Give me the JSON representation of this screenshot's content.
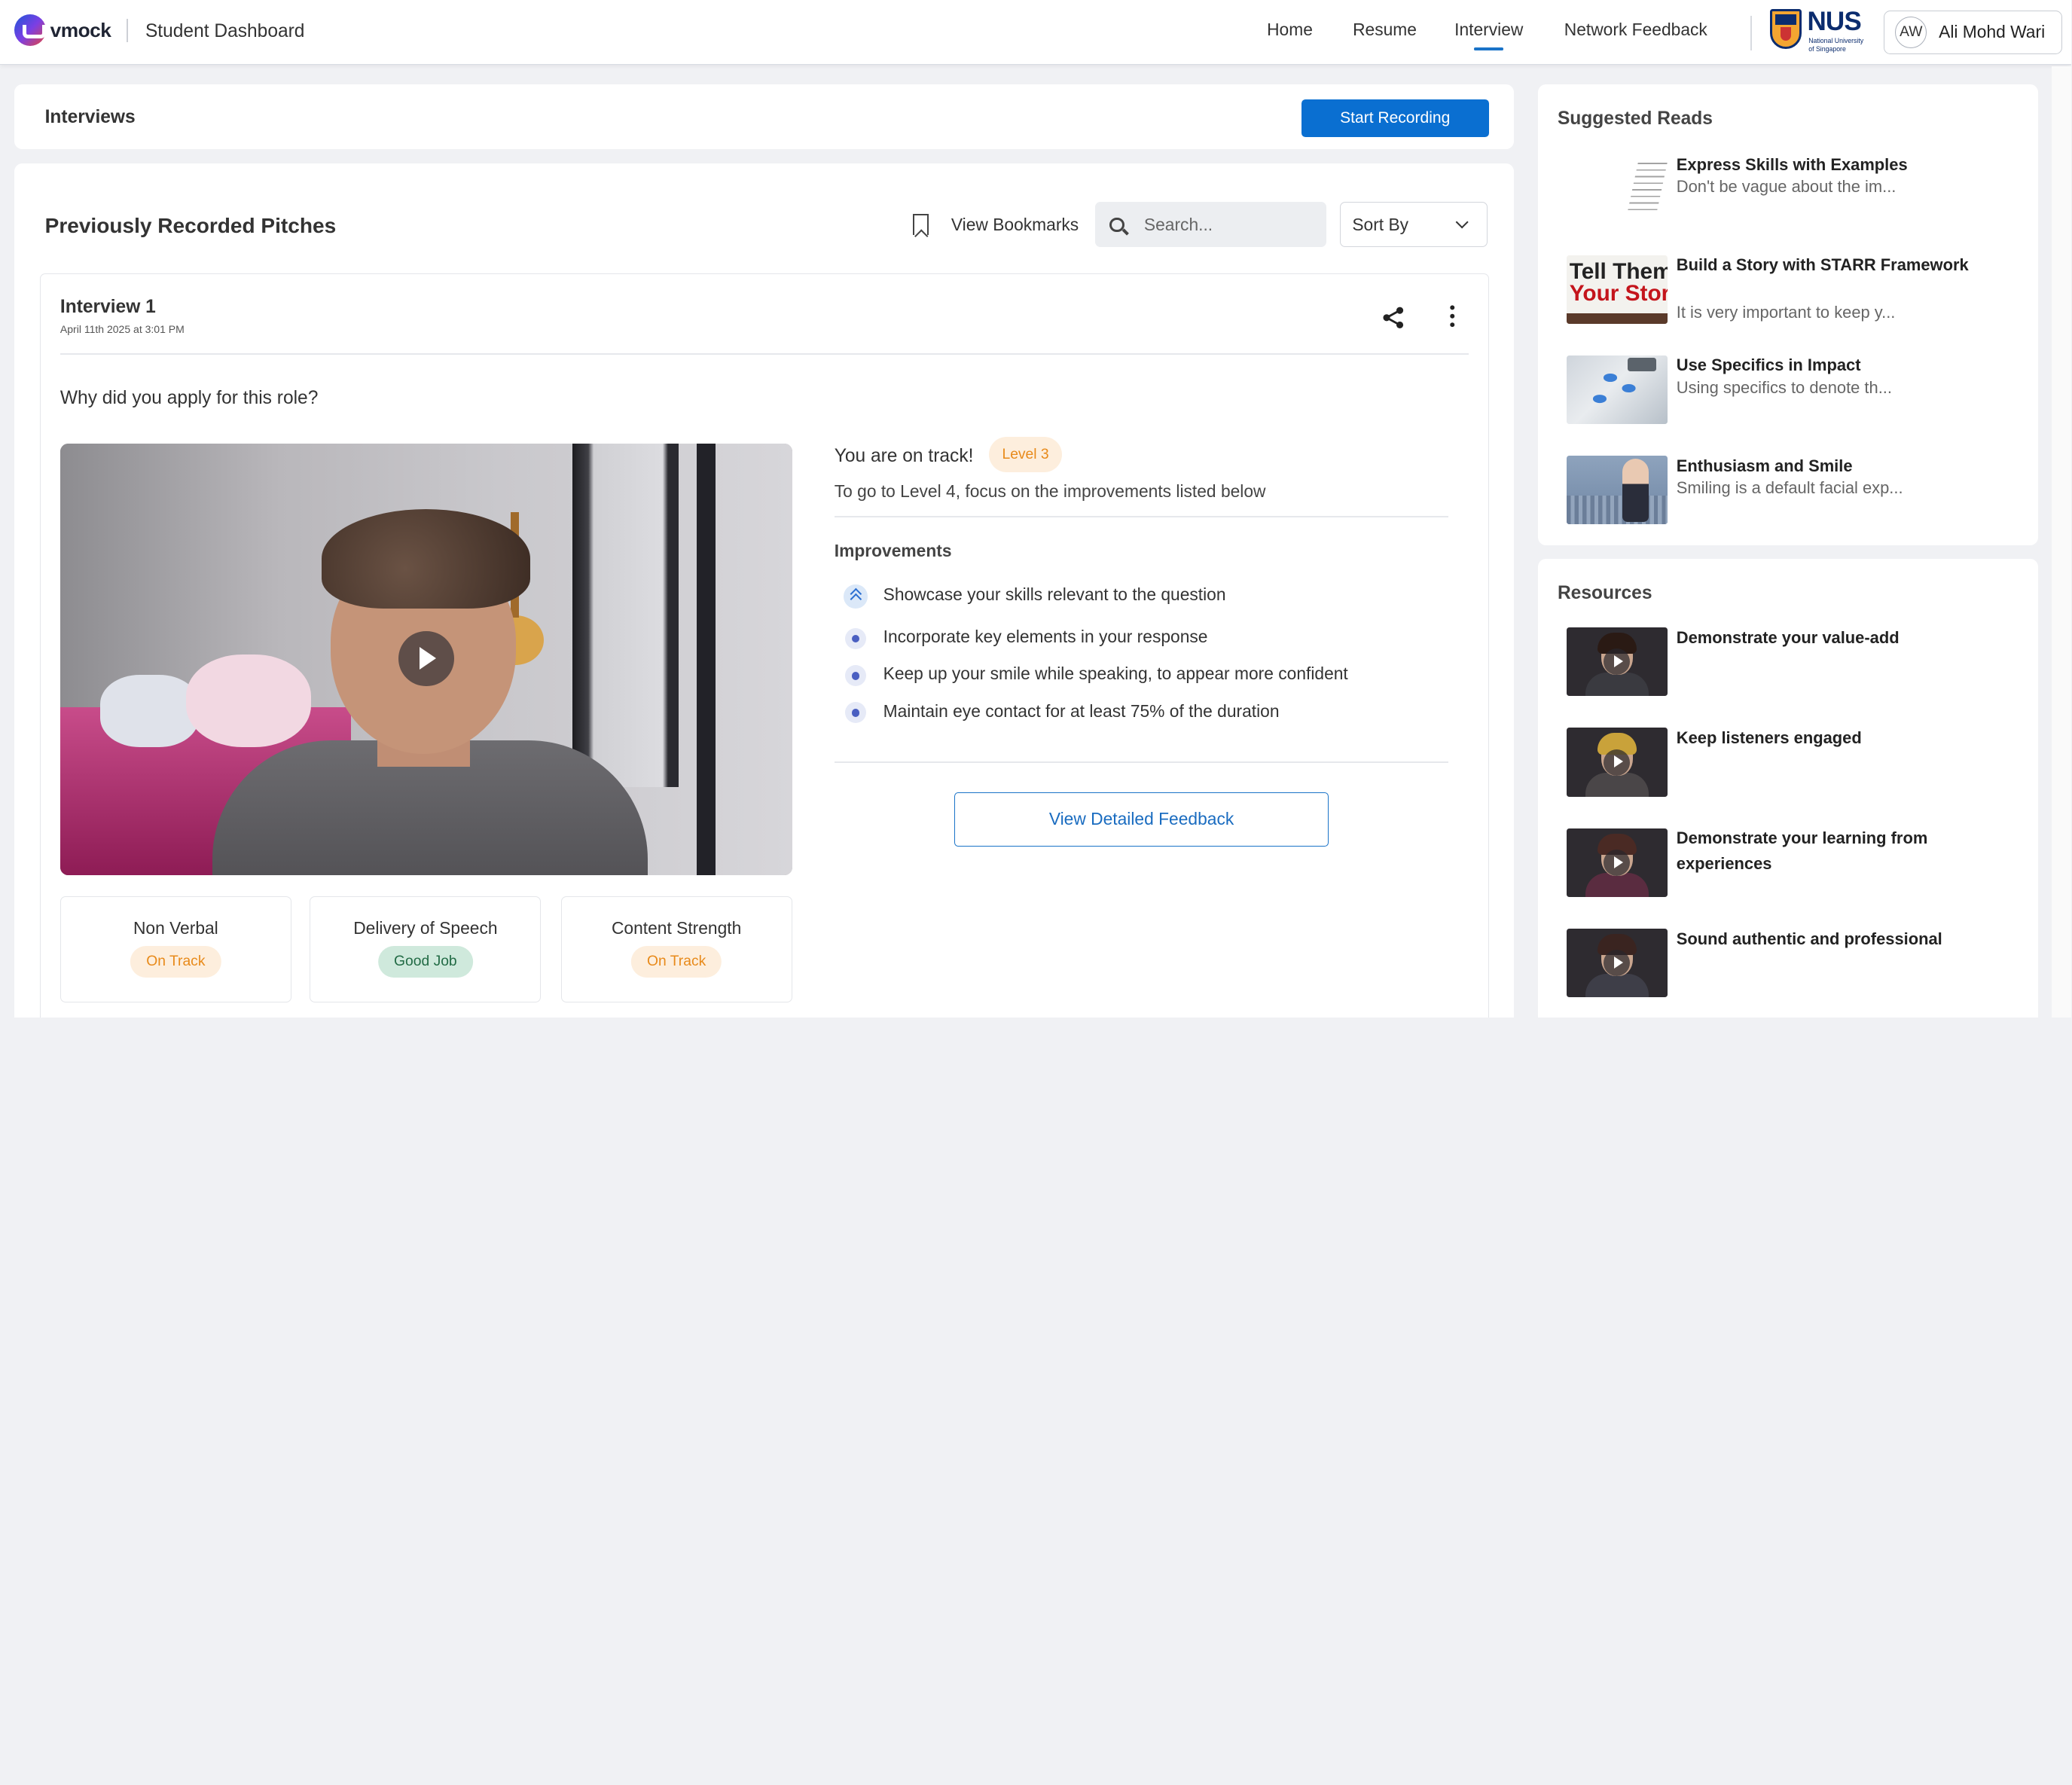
{
  "brand": {
    "logo_text": "vmock",
    "app_title": "Student Dashboard"
  },
  "nav": {
    "items": [
      {
        "label": "Home"
      },
      {
        "label": "Resume"
      },
      {
        "label": "Interview",
        "active": true
      },
      {
        "label": "Network Feedback"
      }
    ],
    "university": {
      "name": "NUS",
      "subtitle": "National University of Singapore"
    },
    "user": {
      "initials": "AW",
      "name": "Ali Mohd Wari"
    }
  },
  "interviews": {
    "title": "Interviews",
    "start_recording_label": "Start Recording"
  },
  "pitches": {
    "title": "Previously Recorded Pitches",
    "bookmarks_label": "View Bookmarks",
    "search_placeholder": "Search...",
    "sort_label": "Sort By",
    "interview": {
      "title": "Interview 1",
      "date": "April 11th 2025 at 3:01 PM",
      "question": "Why did you apply for this role?",
      "status_text": "You are on track!",
      "level_badge": "Level 3",
      "goal_text": "To go to Level 4, focus on the improvements listed below",
      "improvements_title": "Improvements",
      "improvements": [
        "Showcase your skills relevant to the question",
        "Incorporate key elements in your response",
        "Keep up your smile while speaking, to appear more confident",
        "Maintain eye contact for at least 75% of the duration"
      ],
      "detailed_feedback_label": "View Detailed Feedback",
      "metrics": [
        {
          "label": "Non Verbal",
          "status": "On Track",
          "color": "#e88a1a"
        },
        {
          "label": "Delivery of Speech",
          "status": "Good Job",
          "color": "#226b45"
        },
        {
          "label": "Content Strength",
          "status": "On Track",
          "color": "#e88a1a"
        }
      ]
    }
  },
  "suggested_reads": {
    "title": "Suggested Reads",
    "items": [
      {
        "title": "Express Skills with Examples",
        "description": "Don't be vague about the im..."
      },
      {
        "title": "Build a Story with STARR Framework",
        "description": "It is very important to keep y...",
        "thumb_text": [
          "Tell Them",
          "Your Story"
        ]
      },
      {
        "title": "Use Specifics in Impact",
        "description": "Using specifics to denote th..."
      },
      {
        "title": "Enthusiasm and Smile",
        "description": "Smiling is a default facial exp..."
      }
    ]
  },
  "resources": {
    "title": "Resources",
    "items": [
      {
        "title": "Demonstrate your value-add"
      },
      {
        "title": "Keep listeners engaged"
      },
      {
        "title": "Demonstrate your learning from experiences"
      },
      {
        "title": "Sound authentic and professional"
      }
    ]
  },
  "colors": {
    "primary": "#0a6fd1",
    "accent_orange": "#e88a1a",
    "accent_green": "#226b45"
  }
}
